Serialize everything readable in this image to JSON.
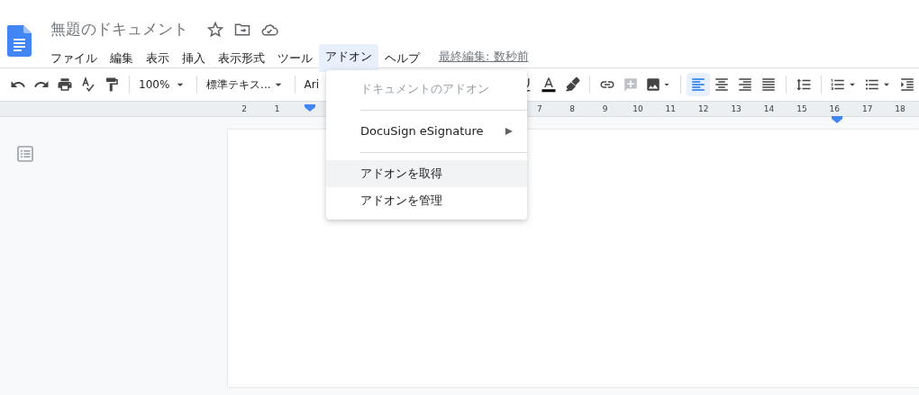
{
  "document": {
    "title": "無題のドキュメント",
    "last_edit": "最終編集: 数秒前"
  },
  "menus": [
    {
      "label": "ファイル",
      "selected": false
    },
    {
      "label": "編集",
      "selected": false
    },
    {
      "label": "表示",
      "selected": false
    },
    {
      "label": "挿入",
      "selected": false
    },
    {
      "label": "表示形式",
      "selected": false
    },
    {
      "label": "ツール",
      "selected": false
    },
    {
      "label": "アドオン",
      "selected": true
    },
    {
      "label": "ヘルプ",
      "selected": false
    }
  ],
  "toolbar": {
    "zoom": "100%",
    "style": "標準テキス...",
    "font": "Ari",
    "alignments": [
      {
        "kind": "left",
        "selected": true
      },
      {
        "kind": "center",
        "selected": false
      },
      {
        "kind": "right",
        "selected": false
      },
      {
        "kind": "justify",
        "selected": false
      }
    ]
  },
  "ruler": {
    "left_numbers": [
      "2",
      "1"
    ],
    "right_numbers": [
      "7",
      "8",
      "9",
      "10",
      "11",
      "12",
      "13",
      "14",
      "15",
      "16",
      "17",
      "18"
    ]
  },
  "addons_menu": {
    "items": [
      {
        "kind": "heading",
        "label": "ドキュメントのアドオン",
        "disabled": true,
        "highlighted": false
      },
      {
        "kind": "divider"
      },
      {
        "kind": "submenu",
        "label": "DocuSign eSignature",
        "disabled": false,
        "highlighted": false
      },
      {
        "kind": "divider"
      },
      {
        "kind": "action",
        "label": "アドオンを取得",
        "disabled": false,
        "highlighted": true
      },
      {
        "kind": "action",
        "label": "アドオンを管理",
        "disabled": false,
        "highlighted": false
      }
    ]
  }
}
